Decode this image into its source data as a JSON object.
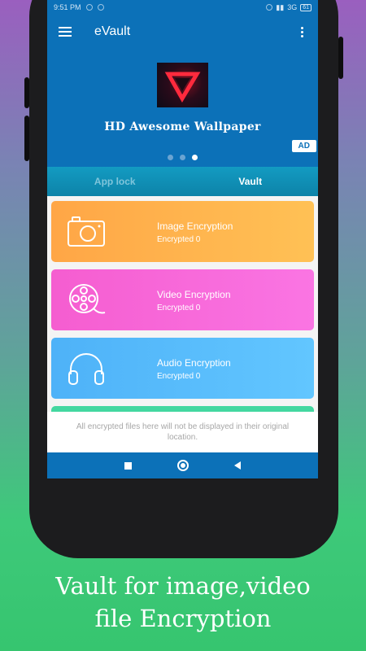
{
  "status": {
    "time": "9:51 PM",
    "network": "3G",
    "battery": "61"
  },
  "app": {
    "title": "eVault"
  },
  "banner": {
    "title": "HD Awesome Wallpaper",
    "ad_label": "AD"
  },
  "tabs": [
    {
      "label": "App lock",
      "active": false
    },
    {
      "label": "Vault",
      "active": true
    }
  ],
  "cards": [
    {
      "title": "Image Encryption",
      "subtitle": "Encrypted 0",
      "icon": "camera-icon",
      "color": "#ffb04e"
    },
    {
      "title": "Video Encryption",
      "subtitle": "Encrypted 0",
      "icon": "film-reel-icon",
      "color": "#f766d8"
    },
    {
      "title": "Audio Encryption",
      "subtitle": "Encrypted 0",
      "icon": "headphones-icon",
      "color": "#57bcfb"
    }
  ],
  "notice": "All encrypted files here will not be displayed in their original location.",
  "caption": {
    "line1": "Vault for image,video",
    "line2": "file Encryption"
  },
  "colors": {
    "primary": "#0c71b8",
    "tab_bar": "#1193bb"
  }
}
